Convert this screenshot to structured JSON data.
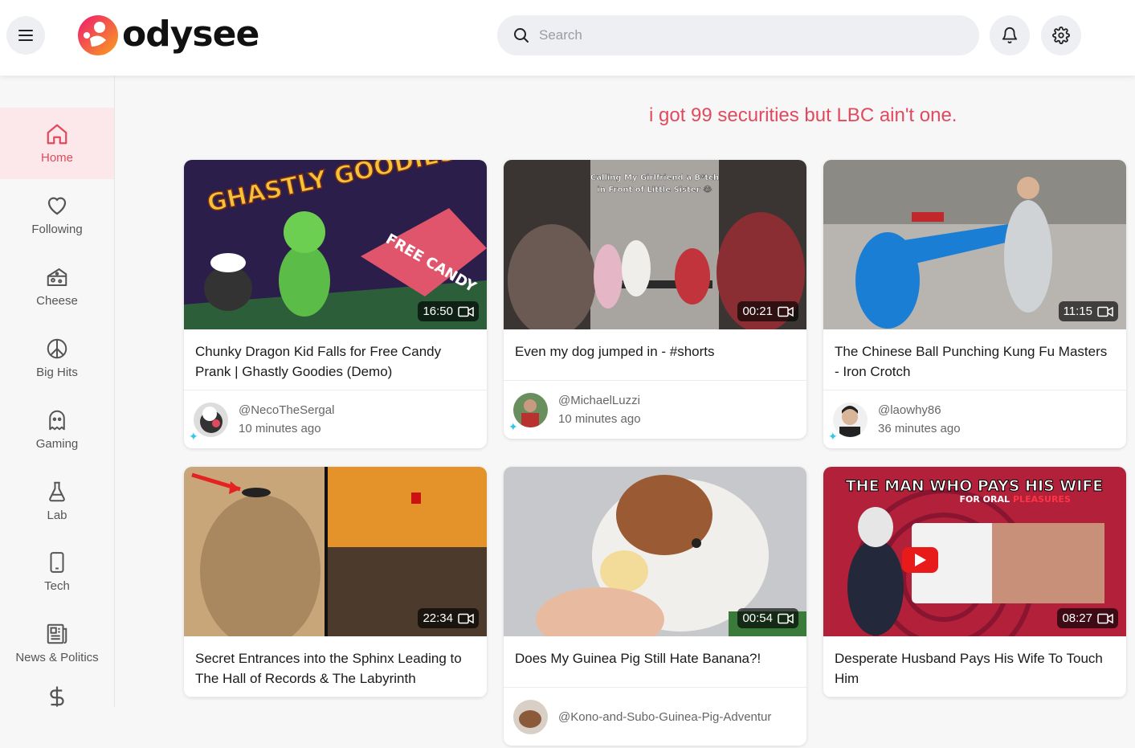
{
  "header": {
    "logo_text": "odysee",
    "search_placeholder": "Search"
  },
  "sidebar": {
    "items": [
      {
        "label": "Home",
        "icon": "home-icon"
      },
      {
        "label": "Following",
        "icon": "heart-icon"
      },
      {
        "label": "Cheese",
        "icon": "cheese-icon"
      },
      {
        "label": "Big Hits",
        "icon": "peace-icon"
      },
      {
        "label": "Gaming",
        "icon": "ghost-icon"
      },
      {
        "label": "Lab",
        "icon": "flask-icon"
      },
      {
        "label": "Tech",
        "icon": "phone-icon"
      },
      {
        "label": "News & Politics",
        "icon": "newspaper-icon"
      },
      {
        "label": "",
        "icon": "dollar-icon"
      }
    ]
  },
  "tagline": "i got 99 securities but LBC ain't one.",
  "thumb_text": {
    "ghastly_title": "GHASTLY GOODIES",
    "free_candy": "FREE CANDY",
    "caption_line1": "Calling My Girlfriend a B*tch",
    "caption_line2": "in Front of Little Sister 😂",
    "husband_line1": "THE MAN WHO PAYS HIS WIFE",
    "husband_line2_a": "FOR ORAL",
    "husband_line2_b": "PLEASURES"
  },
  "cards": [
    {
      "title": "Chunky Dragon Kid Falls for Free Candy Prank | Ghastly Goodies (Demo)",
      "duration": "16:50",
      "channel": "@NecoTheSergal",
      "time": "10 minutes ago"
    },
    {
      "title": "Even my dog jumped in - #shorts",
      "duration": "00:21",
      "channel": "@MichaelLuzzi",
      "time": "10 minutes ago"
    },
    {
      "title": "The Chinese Ball Punching Kung Fu Masters - Iron Crotch",
      "duration": "11:15",
      "channel": "@laowhy86",
      "time": "36 minutes ago"
    },
    {
      "title": "Secret Entrances into the Sphinx Leading to The Hall of Records & The Labyrinth",
      "duration": "22:34",
      "channel": "",
      "time": ""
    },
    {
      "title": "Does My Guinea Pig Still Hate Banana?!",
      "duration": "00:54",
      "channel": "@Kono-and-Subo-Guinea-Pig-Adventur",
      "time": ""
    },
    {
      "title": "Desperate Husband Pays His Wife To Touch Him",
      "duration": "08:27",
      "channel": "",
      "time": ""
    }
  ],
  "colors": {
    "accent": "#e2495d",
    "active_bg": "#fce8ea"
  }
}
